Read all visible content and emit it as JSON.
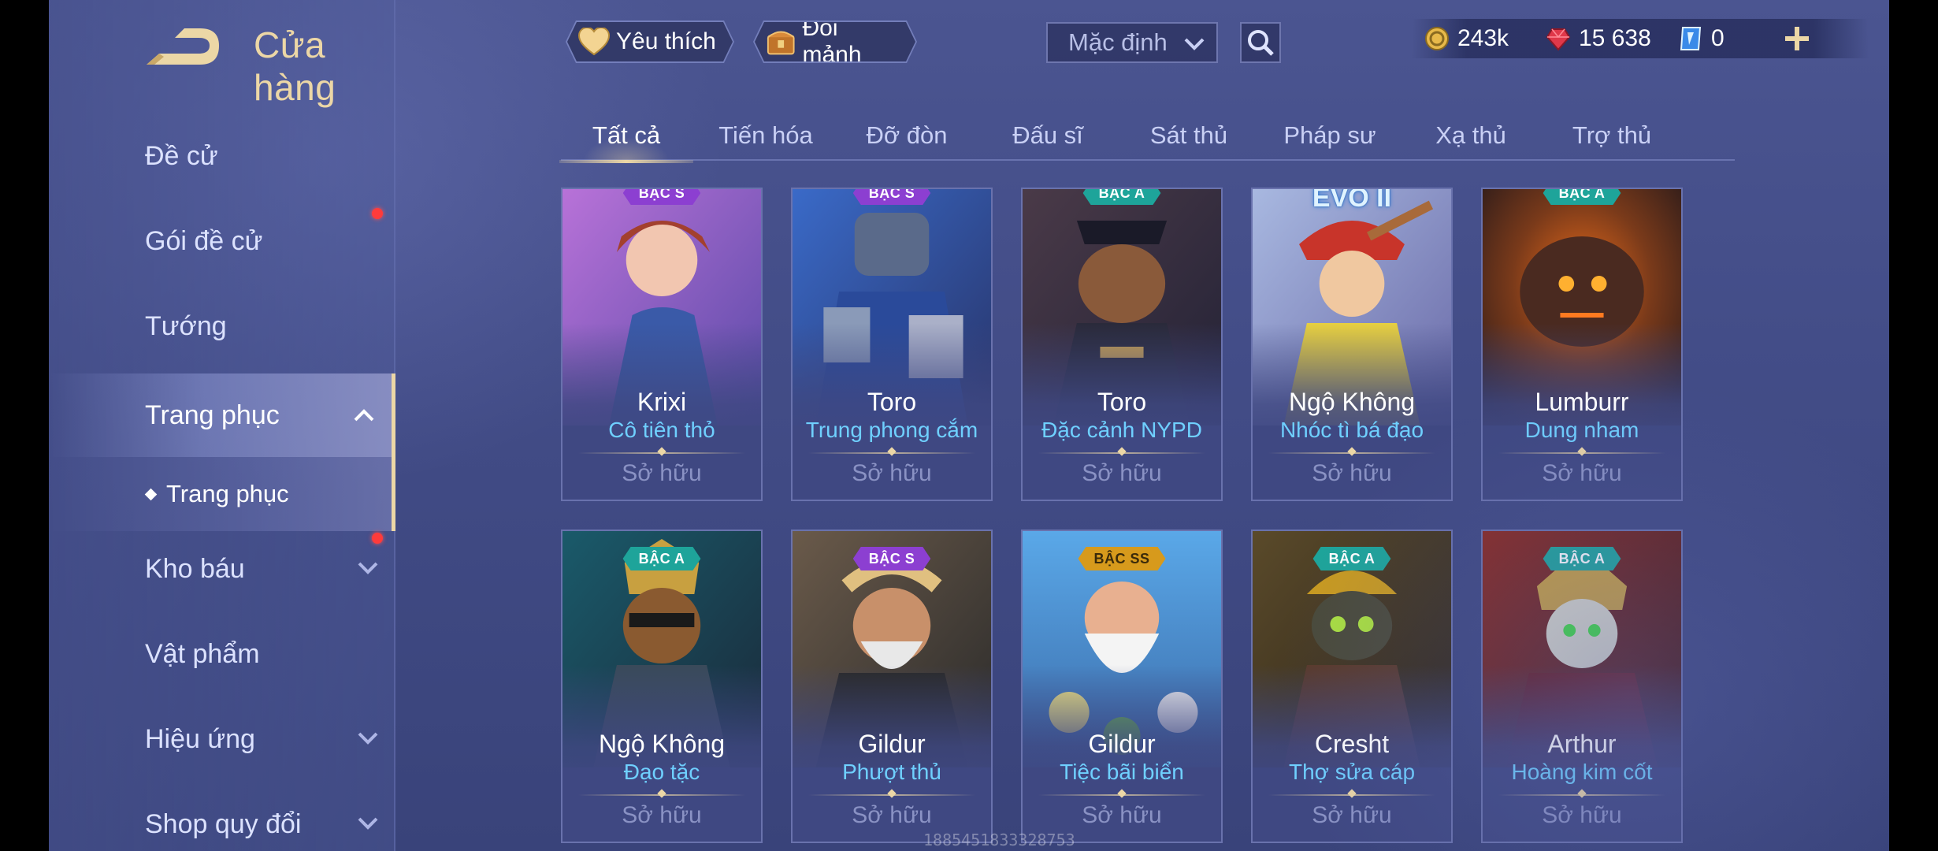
{
  "header": {
    "title": "Cửa hàng",
    "favorite_label": "Yêu thích",
    "exchange_label": "Đổi mảnh",
    "sort_label": "Mặc định"
  },
  "currencies": [
    {
      "icon": "gold-coin-icon",
      "value": "243k"
    },
    {
      "icon": "red-gem-icon",
      "value": "15 638"
    },
    {
      "icon": "blue-voucher-icon",
      "value": "0"
    }
  ],
  "sidebar": {
    "items": [
      {
        "label": "Đề cử"
      },
      {
        "label": "Gói đề cử",
        "notify": true
      },
      {
        "label": "Tướng"
      },
      {
        "label": "Trang phục",
        "expanded": true,
        "active": true
      },
      {
        "label": "Kho báu",
        "notify": true
      },
      {
        "label": "Vật phẩm"
      },
      {
        "label": "Hiệu ứng"
      },
      {
        "label": "Shop quy đổi"
      }
    ],
    "sub_item": "Trang phục"
  },
  "tabs": [
    "Tất cả",
    "Tiến hóa",
    "Đỡ đòn",
    "Đấu sĩ",
    "Sát thủ",
    "Pháp sư",
    "Xạ thủ",
    "Trợ thủ"
  ],
  "active_tab": "Tất cả",
  "cards": [
    {
      "hero": "Krixi",
      "skin": "Cô tiên thỏ",
      "status": "Sở hữu",
      "tier": "BẬC S"
    },
    {
      "hero": "Toro",
      "skin": "Trung phong cắm",
      "status": "Sở hữu",
      "tier": "BẬC S"
    },
    {
      "hero": "Toro",
      "skin": "Đặc cảnh NYPD",
      "status": "Sở hữu",
      "tier": "BẬC A"
    },
    {
      "hero": "Ngộ Không",
      "skin": "Nhóc tì bá đạo",
      "status": "Sở hữu",
      "tier": "EVO II"
    },
    {
      "hero": "Lumburr",
      "skin": "Dung nham",
      "status": "Sở hữu",
      "tier": "BẬC A"
    },
    {
      "hero": "Ngộ Không",
      "skin": "Đạo tặc",
      "status": "Sở hữu",
      "tier": "BẬC A"
    },
    {
      "hero": "Gildur",
      "skin": "Phượt thủ",
      "status": "Sở hữu",
      "tier": "BẬC S"
    },
    {
      "hero": "Gildur",
      "skin": "Tiệc bãi biển",
      "status": "Sở hữu",
      "tier": "BẬC SS"
    },
    {
      "hero": "Cresht",
      "skin": "Thợ sửa cáp",
      "status": "Sở hữu",
      "tier": "BẬC A"
    },
    {
      "hero": "Arthur",
      "skin": "Hoàng kim cốt",
      "status": "Sở hữu",
      "tier": "BẬC A"
    }
  ],
  "watermark": "1885451833328753",
  "colors": {
    "accent_gold": "#ecd7a6",
    "skin_name_blue": "#6fd0ff",
    "notify_red": "#ff3b3b",
    "tier_a": "#1ea49a",
    "tier_s": "#8c3fd1",
    "tier_ss": "#d79a1c"
  }
}
